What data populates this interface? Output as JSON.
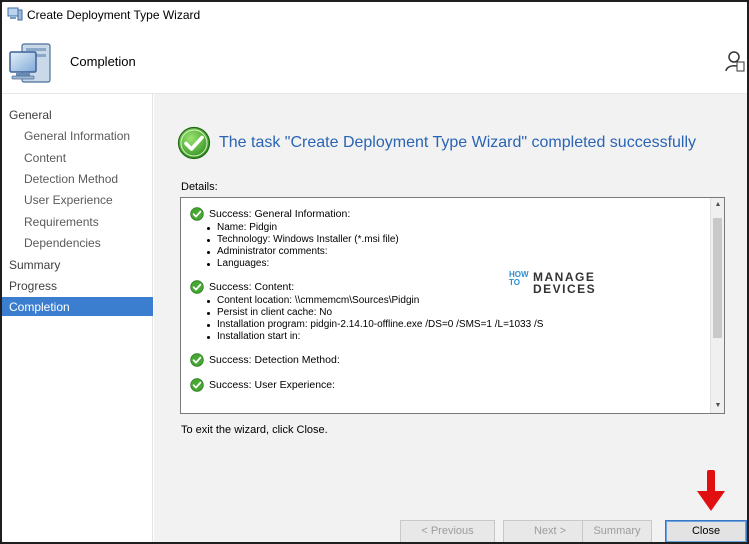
{
  "window": {
    "title": "Create Deployment Type Wizard"
  },
  "header": {
    "title": "Completion"
  },
  "sidebar": {
    "items": [
      {
        "label": "General",
        "level": "top",
        "active": false
      },
      {
        "label": "General Information",
        "level": "sub",
        "active": false
      },
      {
        "label": "Content",
        "level": "sub",
        "active": false
      },
      {
        "label": "Detection Method",
        "level": "sub",
        "active": false
      },
      {
        "label": "User Experience",
        "level": "sub",
        "active": false
      },
      {
        "label": "Requirements",
        "level": "sub",
        "active": false
      },
      {
        "label": "Dependencies",
        "level": "sub",
        "active": false
      },
      {
        "label": "Summary",
        "level": "top",
        "active": false
      },
      {
        "label": "Progress",
        "level": "top",
        "active": false
      },
      {
        "label": "Completion",
        "level": "top",
        "active": true
      }
    ]
  },
  "main": {
    "headline": "The task \"Create Deployment Type Wizard\" completed successfully",
    "details_label": "Details:",
    "details": [
      {
        "title": "Success: General Information:",
        "items": [
          "Name: Pidgin",
          "Technology: Windows Installer (*.msi file)",
          "Administrator comments:",
          "Languages:"
        ]
      },
      {
        "title": "Success: Content:",
        "items": [
          "Content location: \\\\cmmemcm\\Sources\\Pidgin",
          "Persist in client cache: No",
          "Installation program: pidgin-2.14.10-offline.exe /DS=0 /SMS=1 /L=1033 /S",
          "Installation start in:"
        ]
      },
      {
        "title": "Success: Detection Method:",
        "items": []
      },
      {
        "title": "Success: User Experience:",
        "items": []
      }
    ],
    "exit_text": "To exit the wizard, click Close."
  },
  "watermark": {
    "how_to": "HOW TO",
    "brand_line1": "MANAGE",
    "brand_line2": "DEVICES"
  },
  "footer": {
    "previous_label": "< Previous",
    "next_label": "Next >",
    "summary_label": "Summary",
    "close_label": "Close"
  },
  "colors": {
    "accent": "#3b7ed0",
    "headline": "#2a64b4",
    "success": "#3aa12e",
    "arrow": "#e01010"
  }
}
